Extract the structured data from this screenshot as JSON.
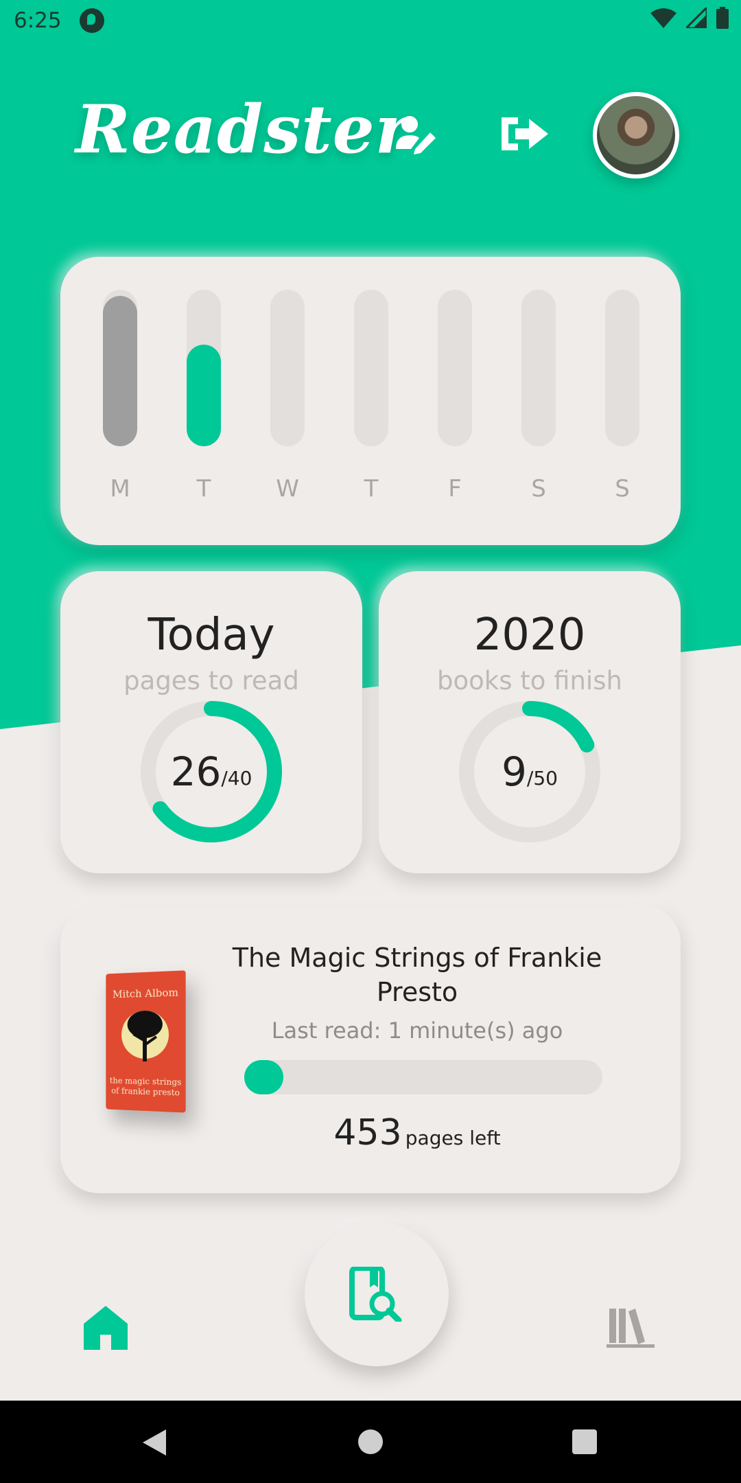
{
  "status_bar": {
    "time": "6:25"
  },
  "header": {
    "app_title": "Readster"
  },
  "weekly": {
    "days": [
      {
        "label": "M",
        "fill": 0.96,
        "color": "#9e9e9e"
      },
      {
        "label": "T",
        "fill": 0.65,
        "color": "#00c896"
      },
      {
        "label": "W",
        "fill": 0,
        "color": "#e2dfdc"
      },
      {
        "label": "T",
        "fill": 0,
        "color": "#e2dfdc"
      },
      {
        "label": "F",
        "fill": 0,
        "color": "#e2dfdc"
      },
      {
        "label": "S",
        "fill": 0,
        "color": "#e2dfdc"
      },
      {
        "label": "S",
        "fill": 0,
        "color": "#e2dfdc"
      }
    ]
  },
  "today_goal": {
    "title": "Today",
    "subtitle": "pages to read",
    "current": "26",
    "total": "/40",
    "progress": 0.65
  },
  "year_goal": {
    "title": "2020",
    "subtitle": "books to finish",
    "current": "9",
    "total": "/50",
    "progress": 0.18
  },
  "current_book": {
    "title": "The Magic Strings of Frankie Presto",
    "last_read": "Last read: 1 minute(s) ago",
    "progress": 0.11,
    "pages_left_value": "453",
    "pages_left_label": "pages left",
    "cover_author": "Mitch Albom",
    "cover_title": "the magic strings of frankie presto"
  },
  "colors": {
    "accent": "#00c896",
    "background": "#efecea",
    "track": "#e2dfdc"
  }
}
